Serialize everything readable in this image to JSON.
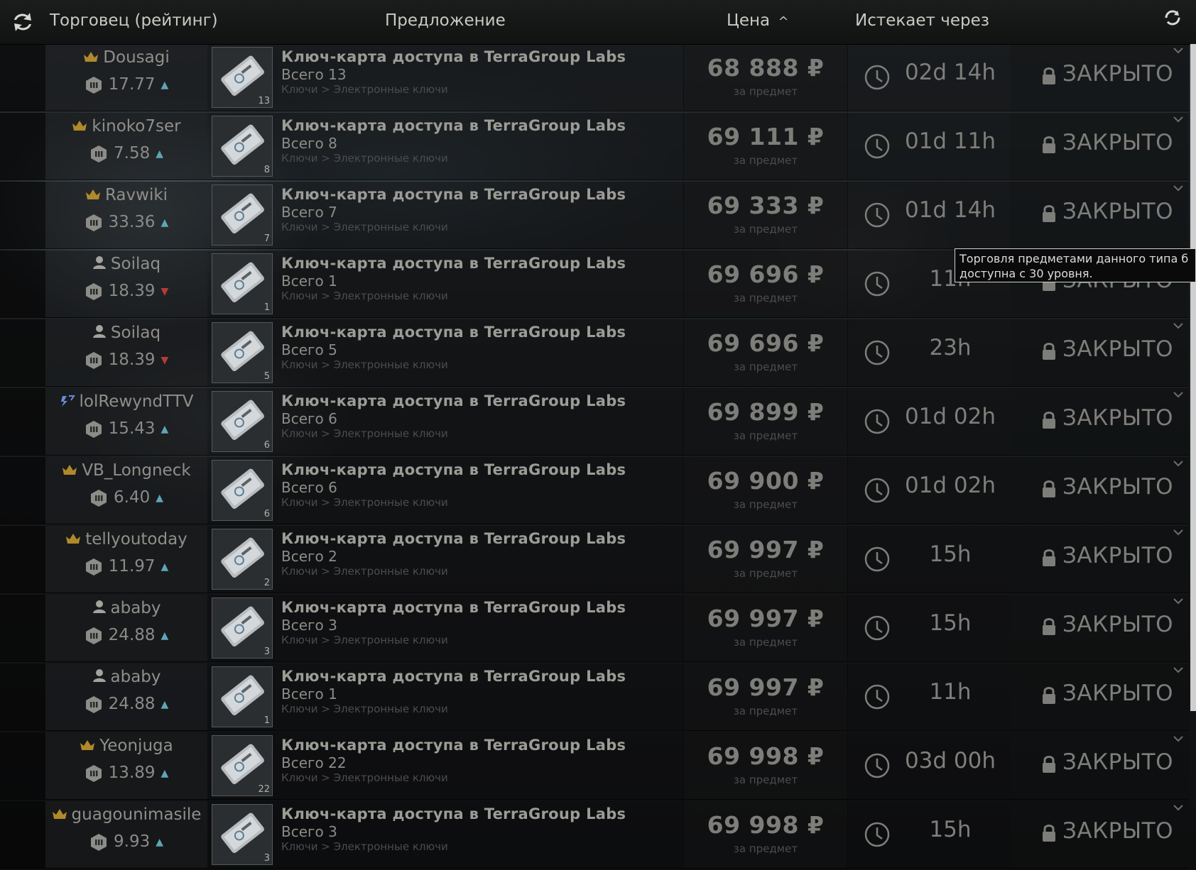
{
  "header": {
    "trader_col": "Торговец (рейтинг)",
    "offer_col": "Предложение",
    "price_col": "Цена",
    "price_sort": "^",
    "expires_col": "Истекает через"
  },
  "common": {
    "item_name": "Ключ-карта доступа в TerraGroup Labs",
    "category": "Ключи > Электронные ключи",
    "per_item": "за предмет",
    "currency": "₽",
    "status": "ЗАКРЫТО"
  },
  "tooltip": {
    "line1": "Торговля предметами данного типа б",
    "line2": "доступна с 30 уровня."
  },
  "colors": {
    "trend_up": "#5da6b6",
    "trend_down": "#b63a3a",
    "crown": "#b08a2a",
    "twitch": "#6a8bd6"
  },
  "offers": [
    {
      "name": "Dousagi",
      "rank": "crown-icon",
      "rating": "17.77",
      "trend": "up",
      "total": "Всего 13",
      "qty": "13",
      "price": "68 888",
      "expires": "02d 14h"
    },
    {
      "name": "kinoko7ser",
      "rank": "crown-icon",
      "rating": "7.58",
      "trend": "up",
      "total": "Всего 8",
      "qty": "8",
      "price": "69 111",
      "expires": "01d 11h"
    },
    {
      "name": "Ravwiki",
      "rank": "crown-icon",
      "rating": "33.36",
      "trend": "up",
      "total": "Всего 7",
      "qty": "7",
      "price": "69 333",
      "expires": "01d 14h"
    },
    {
      "name": "Soilaq",
      "rank": "user-icon",
      "rating": "18.39",
      "trend": "down",
      "total": "Всего 1",
      "qty": "1",
      "price": "69 696",
      "expires": "11h"
    },
    {
      "name": "Soilaq",
      "rank": "user-icon",
      "rating": "18.39",
      "trend": "down",
      "total": "Всего 5",
      "qty": "5",
      "price": "69 696",
      "expires": "23h"
    },
    {
      "name": "lolRewyndTTV",
      "rank": "twitch-icon",
      "rating": "15.43",
      "trend": "up",
      "total": "Всего 6",
      "qty": "6",
      "price": "69 899",
      "expires": "01d 02h"
    },
    {
      "name": "VB_Longneck",
      "rank": "crown-icon",
      "rating": "6.40",
      "trend": "up",
      "total": "Всего 6",
      "qty": "6",
      "price": "69 900",
      "expires": "01d 02h"
    },
    {
      "name": "tellyoutoday",
      "rank": "crown-icon",
      "rating": "11.97",
      "trend": "up",
      "total": "Всего 2",
      "qty": "2",
      "price": "69 997",
      "expires": "15h"
    },
    {
      "name": "ababy",
      "rank": "user-icon",
      "rating": "24.88",
      "trend": "up",
      "total": "Всего 3",
      "qty": "3",
      "price": "69 997",
      "expires": "15h"
    },
    {
      "name": "ababy",
      "rank": "user-icon",
      "rating": "24.88",
      "trend": "up",
      "total": "Всего 1",
      "qty": "1",
      "price": "69 997",
      "expires": "11h"
    },
    {
      "name": "Yeonjuga",
      "rank": "crown-icon",
      "rating": "13.89",
      "trend": "up",
      "total": "Всего 22",
      "qty": "22",
      "price": "69 998",
      "expires": "03d 00h"
    },
    {
      "name": "guagounimasile",
      "rank": "crown-icon",
      "rating": "9.93",
      "trend": "up",
      "total": "Всего 3",
      "qty": "3",
      "price": "69 998",
      "expires": "15h"
    }
  ]
}
